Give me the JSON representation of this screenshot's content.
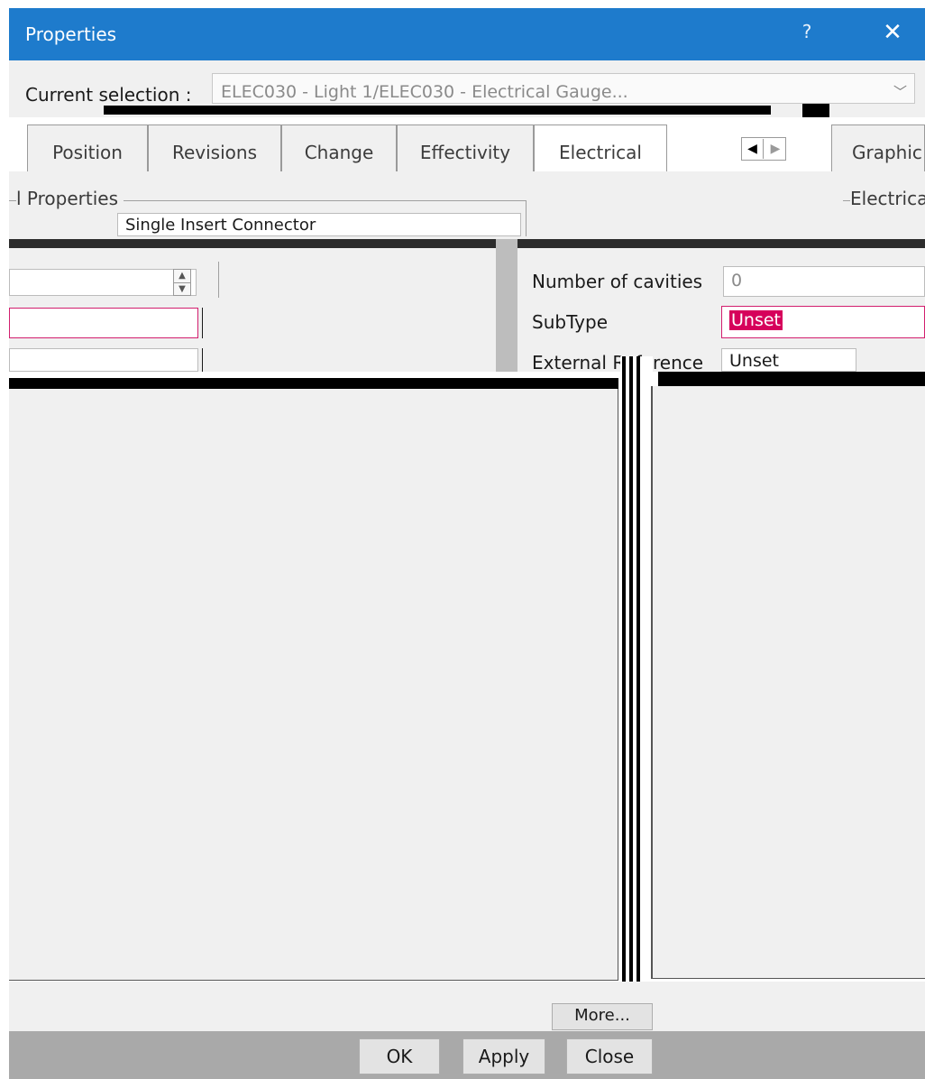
{
  "window": {
    "title": "Properties",
    "help_glyph": "?",
    "close_glyph": "✕"
  },
  "selection": {
    "label": "Current selection :",
    "value": "ELEC030 - Light 1/ELEC030 - Electrical Gauge..."
  },
  "tabs": [
    {
      "label": "Position"
    },
    {
      "label": "Revisions"
    },
    {
      "label": "Change"
    },
    {
      "label": "Effectivity"
    },
    {
      "label": "Electrical"
    }
  ],
  "active_tab": "Electrical",
  "graphic_tab": "Graphic",
  "left_group": {
    "title": "l Properties",
    "connector_type": "Single Insert Connector"
  },
  "right_group": {
    "title": "Electrica",
    "fields": [
      {
        "label": "Number of cavities",
        "value": "0"
      },
      {
        "label": "SubType",
        "value": "Unset"
      },
      {
        "label": "External Reference",
        "value": "Unset"
      }
    ]
  },
  "buttons": {
    "more": "More...",
    "ok": "OK",
    "apply": "Apply",
    "close": "Close"
  },
  "colors": {
    "titlebar": "#1e7bcc",
    "highlight": "#d6005b",
    "field_border_pink": "#d21e6e"
  }
}
